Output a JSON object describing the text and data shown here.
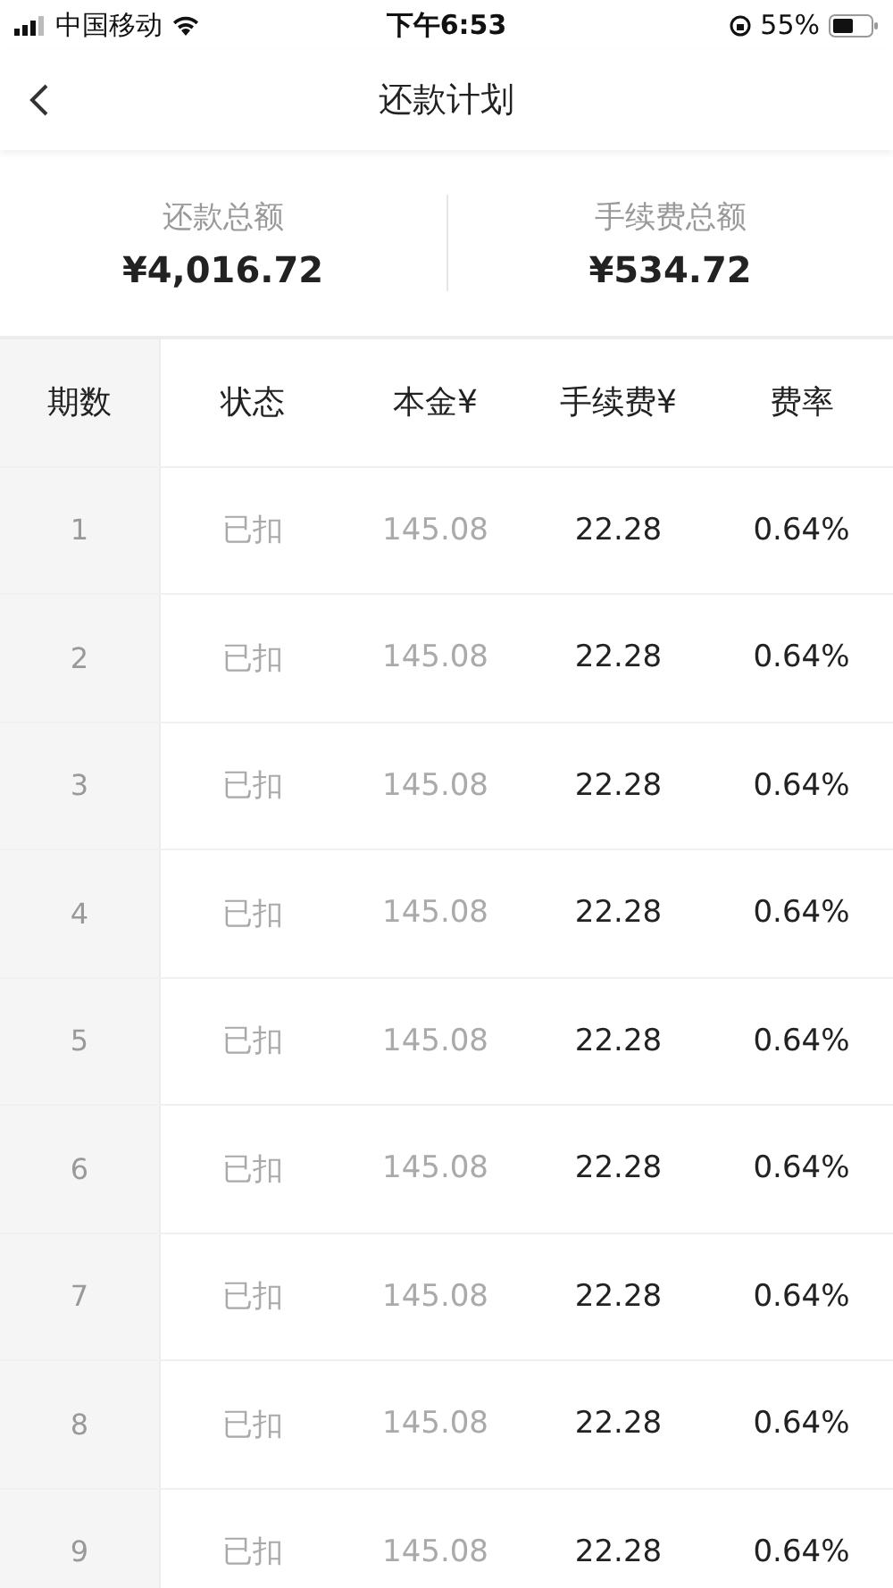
{
  "status_bar": {
    "carrier": "中国移动",
    "time": "下午6:53",
    "battery": "55%"
  },
  "nav": {
    "title": "还款计划"
  },
  "summary": [
    {
      "label": "还款总额",
      "value": "¥4,016.72"
    },
    {
      "label": "手续费总额",
      "value": "¥534.72"
    }
  ],
  "table": {
    "columns": [
      "期数",
      "状态",
      "本金¥",
      "手续费¥",
      "费率"
    ],
    "rows": [
      {
        "period": "1",
        "status": "已扣",
        "principal": "145.08",
        "fee": "22.28",
        "rate": "0.64%",
        "paid": true
      },
      {
        "period": "2",
        "status": "已扣",
        "principal": "145.08",
        "fee": "22.28",
        "rate": "0.64%",
        "paid": true
      },
      {
        "period": "3",
        "status": "已扣",
        "principal": "145.08",
        "fee": "22.28",
        "rate": "0.64%",
        "paid": true
      },
      {
        "period": "4",
        "status": "已扣",
        "principal": "145.08",
        "fee": "22.28",
        "rate": "0.64%",
        "paid": true
      },
      {
        "period": "5",
        "status": "已扣",
        "principal": "145.08",
        "fee": "22.28",
        "rate": "0.64%",
        "paid": true
      },
      {
        "period": "6",
        "status": "已扣",
        "principal": "145.08",
        "fee": "22.28",
        "rate": "0.64%",
        "paid": true
      },
      {
        "period": "7",
        "status": "已扣",
        "principal": "145.08",
        "fee": "22.28",
        "rate": "0.64%",
        "paid": true
      },
      {
        "period": "8",
        "status": "已扣",
        "principal": "145.08",
        "fee": "22.28",
        "rate": "0.64%",
        "paid": true
      },
      {
        "period": "9",
        "status": "已扣",
        "principal": "145.08",
        "fee": "22.28",
        "rate": "0.64%",
        "paid": true
      }
    ]
  }
}
